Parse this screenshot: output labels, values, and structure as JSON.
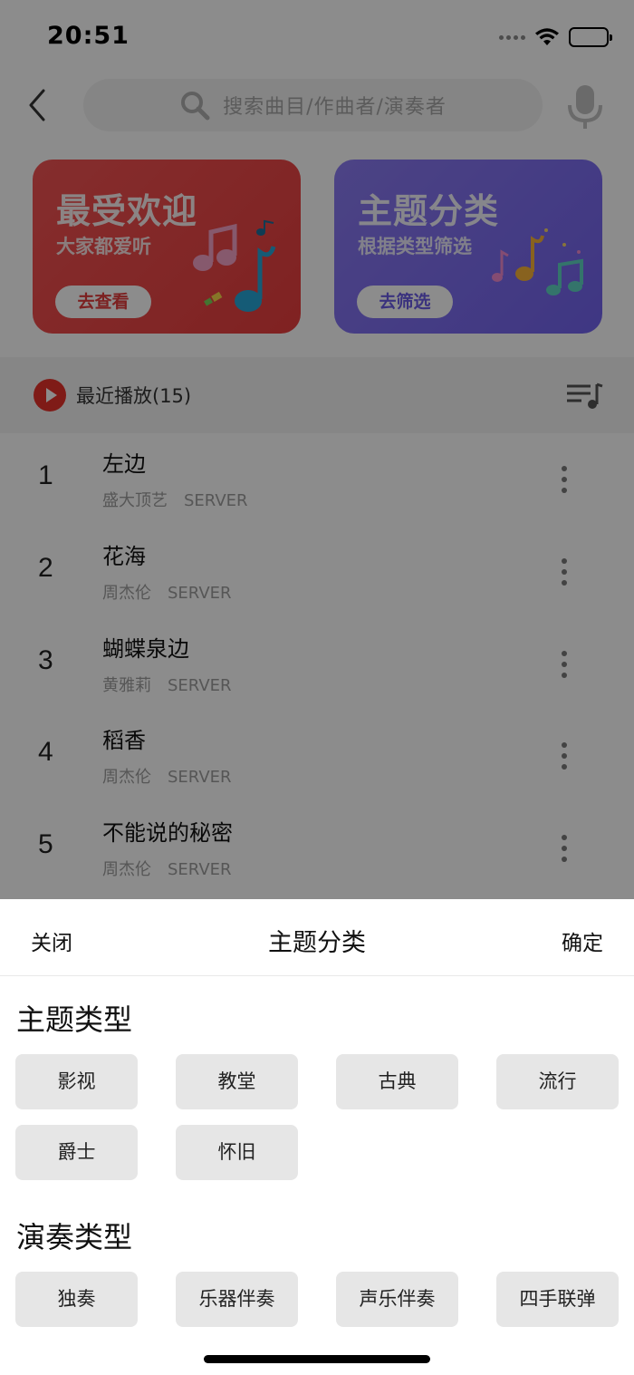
{
  "status_bar": {
    "time": "20:51"
  },
  "search": {
    "placeholder": "搜索曲目/作曲者/演奏者"
  },
  "cards": [
    {
      "title": "最受欢迎",
      "subtitle": "大家都爱听",
      "button": "去查看",
      "color": "#e83e3e"
    },
    {
      "title": "主题分类",
      "subtitle": "根据类型筛选",
      "button": "去筛选",
      "color": "#7363ee"
    }
  ],
  "recent": {
    "label": "最近播放(15)"
  },
  "songs": [
    {
      "index": "1",
      "title": "左边",
      "artist": "盛大顶艺",
      "source": "SERVER"
    },
    {
      "index": "2",
      "title": "花海",
      "artist": "周杰伦",
      "source": "SERVER"
    },
    {
      "index": "3",
      "title": "蝴蝶泉边",
      "artist": "黄雅莉",
      "source": "SERVER"
    },
    {
      "index": "4",
      "title": "稻香",
      "artist": "周杰伦",
      "source": "SERVER"
    },
    {
      "index": "5",
      "title": "不能说的秘密",
      "artist": "周杰伦",
      "source": "SERVER"
    }
  ],
  "sheet": {
    "close": "关闭",
    "title": "主题分类",
    "confirm": "确定",
    "sections": [
      {
        "title": "主题类型",
        "tags": [
          "影视",
          "教堂",
          "古典",
          "流行",
          "爵士",
          "怀旧"
        ]
      },
      {
        "title": "演奏类型",
        "tags": [
          "独奏",
          "乐器伴奏",
          "声乐伴奏",
          "四手联弹"
        ]
      }
    ]
  },
  "colors": {
    "overlay": "rgba(0,0,0,0.45)",
    "tag_bg": "#e6e6e6",
    "accent_red": "#e7322b"
  }
}
